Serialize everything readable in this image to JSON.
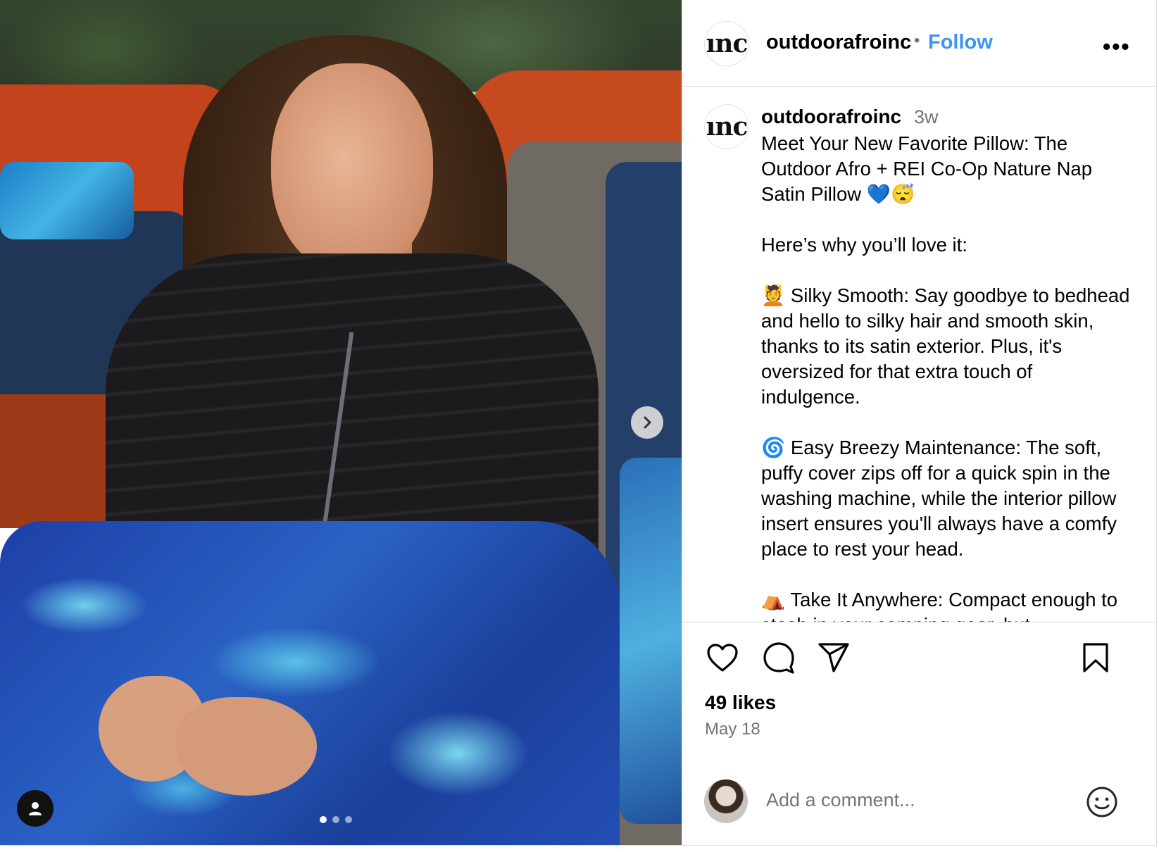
{
  "post": {
    "username": "outdoorafroinc",
    "separator": "•",
    "follow_label": "Follow",
    "more_label": "•••",
    "avatar_text": "ınc",
    "caption_username": "outdoorafroinc",
    "caption_time": "3w",
    "caption_text": "Meet Your New Favorite Pillow: The Outdoor Afro + REI Co-Op Nature Nap Satin Pillow 💙😴\n\nHere’s why you’ll love it:\n\n💆 Silky Smooth: Say goodbye to bedhead and hello to silky hair and smooth skin, thanks to its satin exterior. Plus, it's oversized for that extra touch of indulgence.\n\n🌀 Easy Breezy Maintenance: The soft, puffy cover zips off for a quick spin in the washing machine, while the interior pillow insert ensures you'll always have a comfy place to rest your head.\n\n⛺ Take It Anywhere: Compact enough to stash in your camping gear, but",
    "likes": "49 likes",
    "date": "May 18"
  },
  "comment": {
    "placeholder": "Add a comment..."
  },
  "carousel": {
    "slide_count": 3,
    "active_slide": 1
  },
  "icons": [
    "heart-icon",
    "comment-icon",
    "share-icon",
    "bookmark-icon",
    "chevron-right-icon",
    "user-tag-icon",
    "emoji-icon",
    "more-icon"
  ],
  "colors": {
    "follow": "#3b95f6",
    "muted": "#737373",
    "border": "#dbdbdb"
  }
}
